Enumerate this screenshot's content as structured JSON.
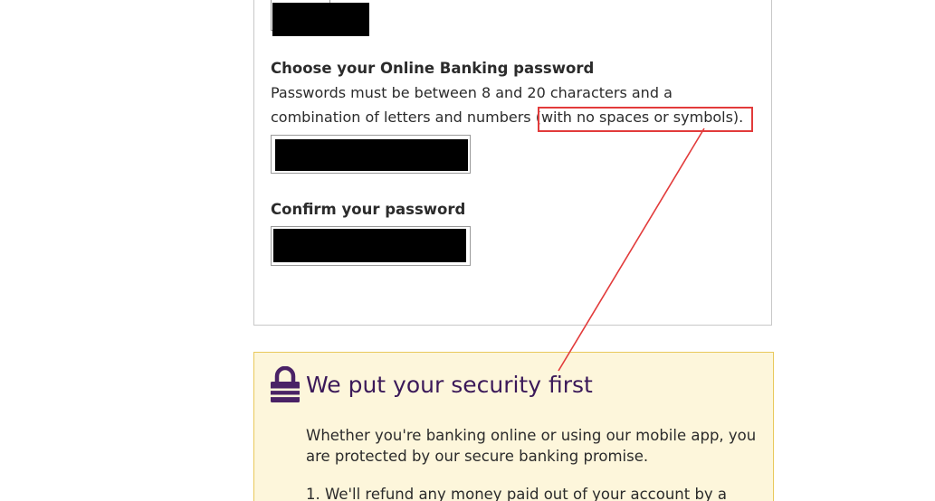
{
  "form": {
    "password_label": "Choose your Online Banking password",
    "password_hint_line1": "Passwords must be between 8 and 20 characters and a",
    "password_hint_line2_prefix": "combination of letters and numbers ",
    "password_hint_highlight": "(with no spaces or symbols).",
    "confirm_label": "Confirm your password"
  },
  "security": {
    "icon": "lock-icon",
    "title": "We put your security first",
    "body": "Whether you're banking online or using our mobile app, you are protected by our secure banking promise.",
    "item_1": "1. We'll refund any money paid out of your account by a"
  },
  "colors": {
    "annotation": "#e23b3b",
    "brand_purple": "#3b1959",
    "security_bg": "#fdf6db",
    "security_border": "#e9c95c"
  }
}
